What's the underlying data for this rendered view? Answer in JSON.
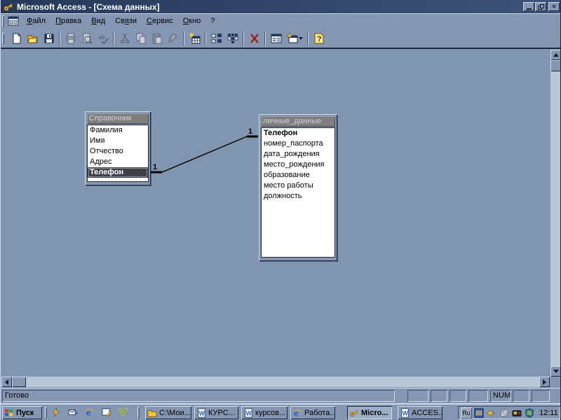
{
  "window": {
    "title": "Microsoft Access - [Схема данных]",
    "app_icon": "access-key-icon"
  },
  "menu": {
    "items": [
      {
        "pre": "",
        "key": "Ф",
        "post": "айл"
      },
      {
        "pre": "",
        "key": "П",
        "post": "равка"
      },
      {
        "pre": "",
        "key": "В",
        "post": "ид"
      },
      {
        "pre": "Св",
        "key": "я",
        "post": "зи"
      },
      {
        "pre": "",
        "key": "С",
        "post": "ервис"
      },
      {
        "pre": "",
        "key": "О",
        "post": "кно"
      },
      {
        "pre": "?",
        "key": "",
        "post": ""
      }
    ]
  },
  "toolbar": {
    "buttons": [
      "new",
      "open",
      "save",
      "print",
      "print-preview",
      "spelling",
      "cut",
      "copy",
      "paste",
      "format-painter",
      "show-table",
      "direct-relationships",
      "all-relationships",
      "delete",
      "database-window",
      "new-object",
      "help"
    ]
  },
  "relationships": {
    "tables": [
      {
        "title": "Справочник",
        "fields": [
          "Фамилия",
          "Имя",
          "Отчество",
          "Адрес",
          "Телефон"
        ],
        "selected_field": "Телефон"
      },
      {
        "title": "личные_данные",
        "fields": [
          "Телефон",
          "номер_паспорта",
          "дата_рождения",
          "место_рождения",
          "образование",
          "место работы",
          "должность"
        ],
        "key_field": "Телефон"
      }
    ],
    "relation": {
      "one_left": "1",
      "one_right": "1"
    }
  },
  "statusbar": {
    "message": "Готово",
    "num": "NUM"
  },
  "taskbar": {
    "start": "Пуск",
    "quick_launch": [
      "lightning",
      "mail",
      "internet-explorer",
      "desktop",
      "v-logo"
    ],
    "buttons": [
      {
        "icon": "folder",
        "label": "C:\\Мои...",
        "active": false
      },
      {
        "icon": "word",
        "label": "КУРС...",
        "active": false
      },
      {
        "icon": "word",
        "label": "курсов...",
        "active": false
      },
      {
        "icon": "internet-explorer",
        "label": "Работа...",
        "active": false
      },
      {
        "icon": "access-key",
        "label": "Micro...",
        "active": true
      },
      {
        "icon": "word",
        "label": "ACCES...",
        "active": false
      }
    ],
    "tray": {
      "lang": "Ru",
      "clock": "12:11",
      "icons": [
        "lang-indicator",
        "bars-indicator",
        "volume",
        "disabled-swirl",
        "camera",
        "norton-shield"
      ]
    }
  }
}
